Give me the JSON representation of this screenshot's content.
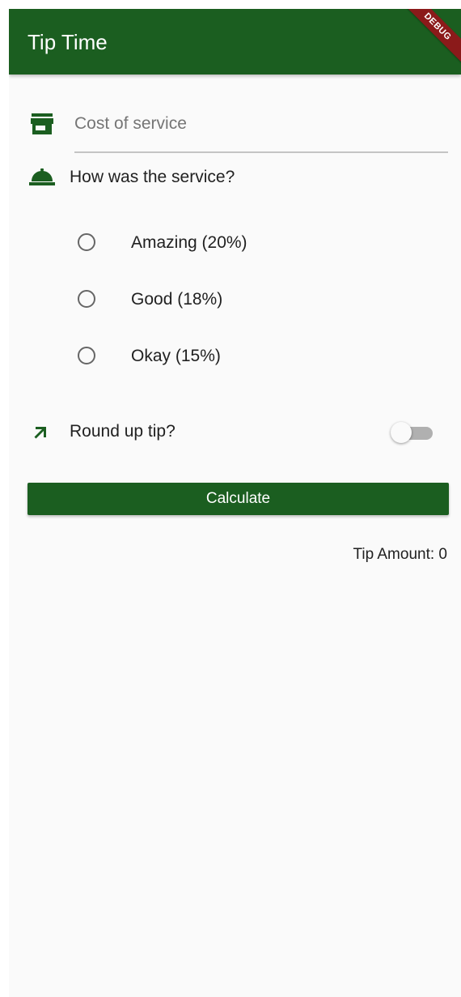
{
  "app_bar": {
    "title": "Tip Time",
    "debug_banner": "DEBUG",
    "color": "#1b5e20"
  },
  "cost_field": {
    "icon": "store-icon",
    "placeholder": "Cost of service",
    "value": ""
  },
  "service_question": {
    "icon": "room-service-icon",
    "label": "How was the service?"
  },
  "tip_options": [
    {
      "label": "Amazing (20%)",
      "selected": false
    },
    {
      "label": "Good (18%)",
      "selected": false
    },
    {
      "label": "Okay (15%)",
      "selected": false
    }
  ],
  "round_up": {
    "icon": "north-east-arrow-icon",
    "label": "Round up tip?",
    "enabled": false
  },
  "calculate_button": {
    "label": "Calculate"
  },
  "result": {
    "tip_amount_text": "Tip Amount: 0"
  }
}
